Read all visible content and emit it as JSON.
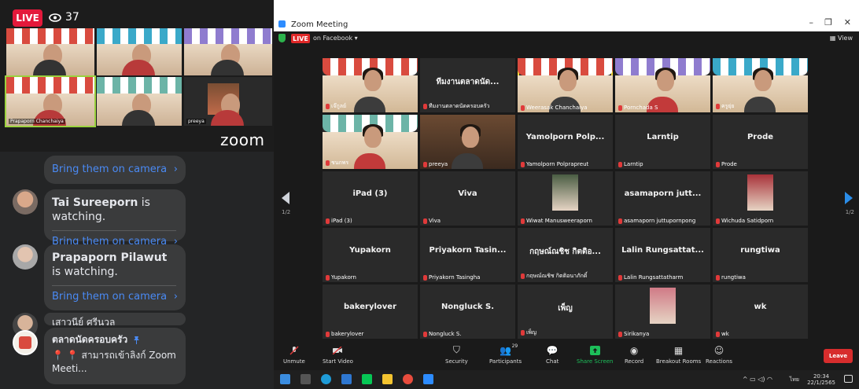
{
  "facebook": {
    "live_badge": "LIVE",
    "viewer_count": "37",
    "zoom_logo": "zoom",
    "preview_names": [
      "",
      "",
      "",
      "Prapaporn Chanchaiya",
      "",
      "preeya"
    ],
    "events": [
      {
        "name": "",
        "suffix": "",
        "cta": "Bring them on camera"
      },
      {
        "name": "Tai Sureeporn",
        "suffix": " is watching.",
        "cta": "Bring them on camera"
      },
      {
        "name": "Prapaporn Pilawut",
        "suffix": " is watching.",
        "cta": "Bring them on camera"
      }
    ],
    "partial_name": "เสาวนีย์ ศรีนวล",
    "pinned": {
      "author": "ตลาดนัดครอบครัว",
      "pin_icon": "pushpin-icon",
      "text": "📍 📍 สามารถเข้าลิงก์ Zoom Meeti..."
    }
  },
  "zoom": {
    "window_title": "Zoom Meeting",
    "live_badge": "LIVE",
    "live_target": "on Facebook",
    "view_label": "View",
    "page_left": "1/2",
    "page_right": "1/2",
    "tiles": [
      {
        "label": "",
        "name": "เจ๊กูลย์",
        "video": true,
        "awning": "#d94b3f"
      },
      {
        "label": "ทีมงานตลาดนัด...",
        "name": "ทีมงานตลาดนัดครอบครัว",
        "video": false
      },
      {
        "label": "",
        "name": "Weerasak Chanchaiya",
        "video": true,
        "awning": "#d94b3f",
        "highlight": true
      },
      {
        "label": "",
        "name": "Pornchada S",
        "video": true,
        "awning": "#8f7ccf"
      },
      {
        "label": "",
        "name": "ครูยุ่ย",
        "video": true,
        "awning": "#3aa9c9"
      },
      {
        "label": "",
        "name": "ชนกพร",
        "video": true,
        "awning": "#6cb4a7"
      },
      {
        "label": "",
        "name": "preeya",
        "video": true,
        "awning": ""
      },
      {
        "label": "Yamolporn Polp...",
        "name": "Yamolporn Polprapreut",
        "video": false
      },
      {
        "label": "Larntip",
        "name": "Larntip",
        "video": false
      },
      {
        "label": "Prode",
        "name": "Prode",
        "video": false
      },
      {
        "label": "iPad (3)",
        "name": "iPad (3)",
        "video": false
      },
      {
        "label": "Viva",
        "name": "Viva",
        "video": false
      },
      {
        "label": "",
        "name": "Wiwat Manusweeraporn",
        "video": false,
        "photo": "#4a5d43"
      },
      {
        "label": "asamaporn jutt...",
        "name": "asamaporn juttupornpong",
        "video": false
      },
      {
        "label": "",
        "name": "Wichuda Satidporn",
        "video": false,
        "photo": "#a8323a"
      },
      {
        "label": "Yupakorn",
        "name": "Yupakorn",
        "video": false
      },
      {
        "label": "Priyakorn Tasin...",
        "name": "Priyakorn Tasingha",
        "video": false
      },
      {
        "label": "กฤษณ์ณชิช กิตติอ...",
        "name": "กฤษณ์ณชิช กิตติอนาภักดิ์",
        "video": false
      },
      {
        "label": "Lalin Rungsattat...",
        "name": "Lalin Rungsattatharm",
        "video": false
      },
      {
        "label": "rungtiwa",
        "name": "rungtiwa",
        "video": false
      },
      {
        "label": "bakerylover",
        "name": "bakerylover",
        "video": false
      },
      {
        "label": "Nongluck S.",
        "name": "Nongluck S.",
        "video": false
      },
      {
        "label": "เพ็ญ",
        "name": "เพ็ญ",
        "video": false
      },
      {
        "label": "",
        "name": "Sirikanya",
        "video": false,
        "photo": "#d07a86"
      },
      {
        "label": "wk",
        "name": "wk",
        "video": false
      }
    ],
    "toolbar": {
      "unmute": "Unmute",
      "start_video": "Start Video",
      "security": "Security",
      "participants": "Participants",
      "participants_count": "29",
      "chat": "Chat",
      "share_screen": "Share Screen",
      "record": "Record",
      "breakout": "Breakout Rooms",
      "reactions": "Reactions",
      "leave": "Leave"
    },
    "taskbar": {
      "time": "20:34",
      "date": "22/1/2565",
      "lang": "ไทย"
    },
    "accent_green": "#1dbf5a",
    "leave_red": "#d72d2d"
  }
}
